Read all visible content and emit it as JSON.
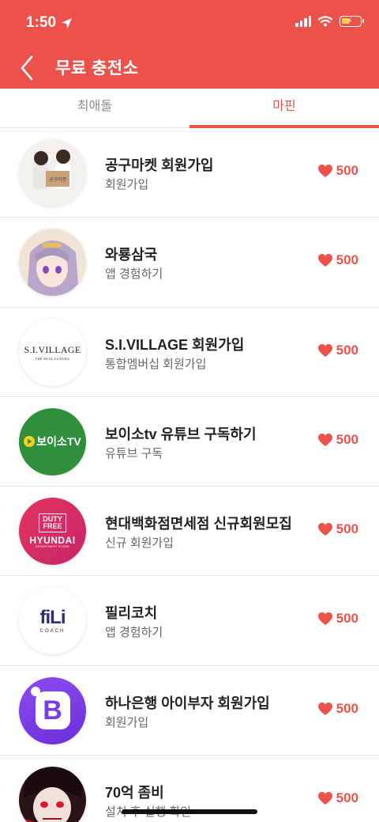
{
  "status_bar": {
    "time": "1:50"
  },
  "header": {
    "title": "무료 충전소"
  },
  "tabs": [
    {
      "label": "최애돌",
      "active": false
    },
    {
      "label": "마핀",
      "active": true
    }
  ],
  "colors": {
    "accent": "#ea524b"
  },
  "items": [
    {
      "title": "공구마켓 회원가입",
      "subtitle": "회원가입",
      "reward": "500",
      "logo": "gongu-market-photo"
    },
    {
      "title": "와룡삼국",
      "subtitle": "앱 경험하기",
      "reward": "500",
      "logo": "anime-character"
    },
    {
      "title": "S.I.VILLAGE 회원가입",
      "subtitle": "통합멤버십 회원가입",
      "reward": "500",
      "logo": "si-village-logo",
      "logo_text": "S.I.VILLAGE",
      "logo_subtext": "THE REAL LUXURY"
    },
    {
      "title": "보이소tv 유튜브 구독하기",
      "subtitle": "유튜브 구독",
      "reward": "500",
      "logo": "boiso-tv-logo",
      "logo_text": "보이소TV"
    },
    {
      "title": "현대백화점면세점 신규회원모집",
      "subtitle": "신규 회원가입",
      "reward": "500",
      "logo": "hyundai-duty-free-logo",
      "logo_line1": "DUTY",
      "logo_line2": "FREE",
      "logo_line3": "HYUNDAI",
      "logo_line4": "DEPARTMENT STORE"
    },
    {
      "title": "필리코치",
      "subtitle": "앱 경험하기",
      "reward": "500",
      "logo": "fili-coach-logo",
      "logo_text": "fiLi",
      "logo_subtext": "COACH"
    },
    {
      "title": "하나은행 아이부자 회원가입",
      "subtitle": "회원가입",
      "reward": "500",
      "logo": "ibuja-logo",
      "logo_text": "B"
    },
    {
      "title": "70억 좀비",
      "subtitle": "설치 후 실행 확인",
      "reward": "500",
      "logo": "zombie-character"
    }
  ]
}
